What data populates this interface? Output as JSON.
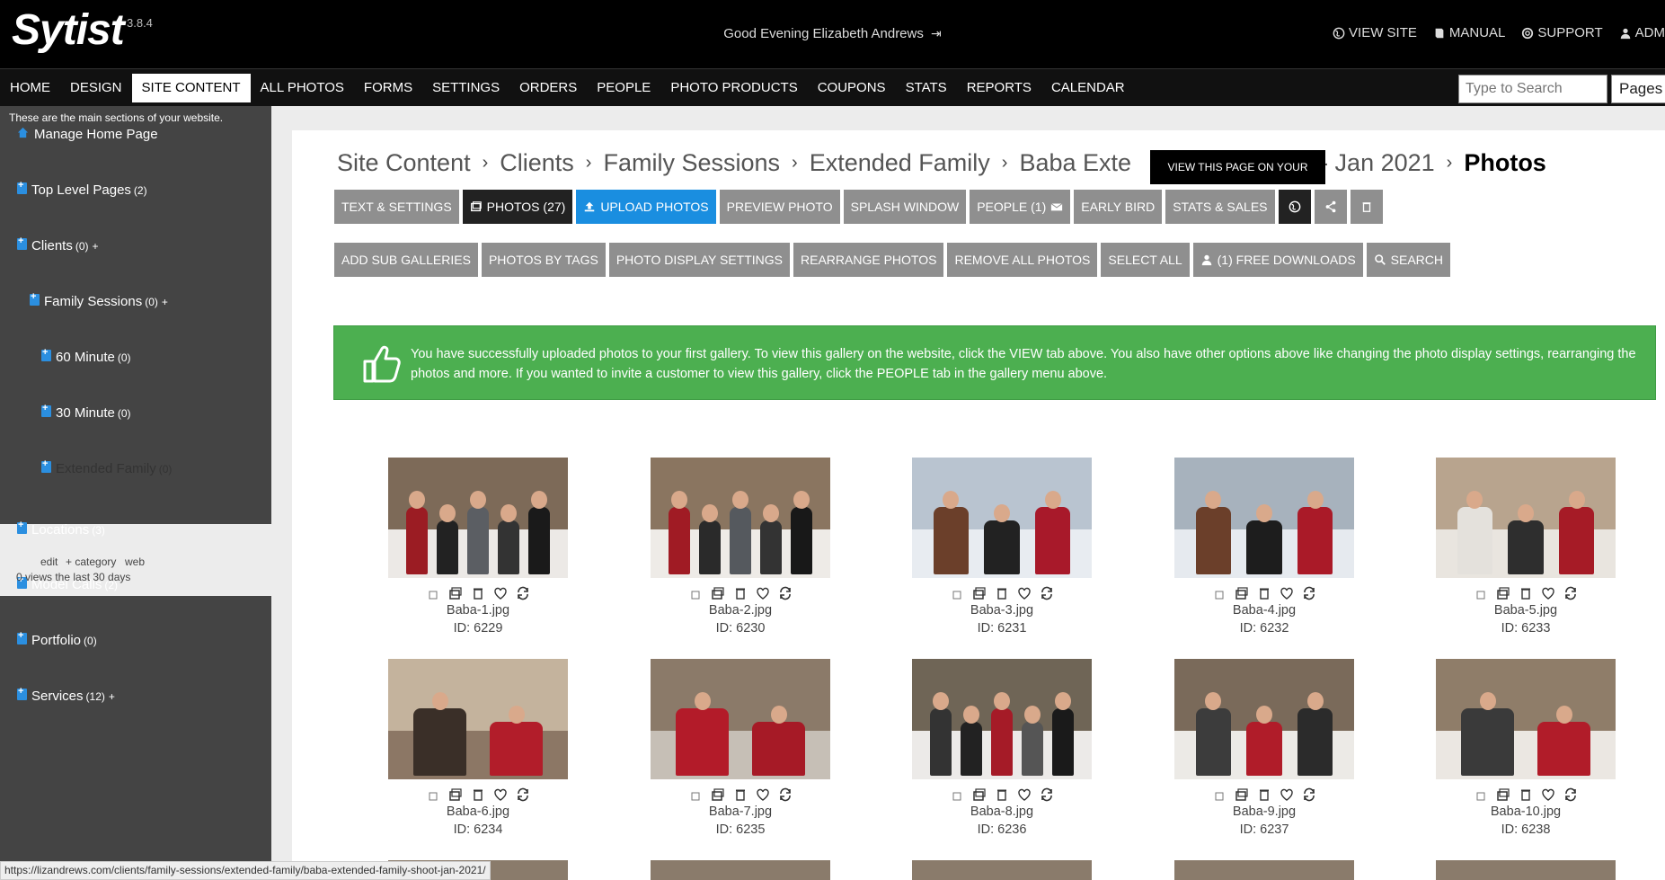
{
  "app": {
    "logo": "Sytist",
    "version": "3.8.4",
    "greeting": "Good Evening Elizabeth Andrews",
    "top_links": [
      {
        "label": "VIEW SITE",
        "icon": "globe-icon"
      },
      {
        "label": "MANUAL",
        "icon": "book-icon"
      },
      {
        "label": "SUPPORT",
        "icon": "lifebuoy-icon"
      },
      {
        "label": "ADM",
        "icon": "user-icon"
      }
    ]
  },
  "nav": {
    "items": [
      "HOME",
      "DESIGN",
      "SITE CONTENT",
      "ALL PHOTOS",
      "FORMS",
      "SETTINGS",
      "ORDERS",
      "PEOPLE",
      "PHOTO PRODUCTS",
      "COUPONS",
      "STATS",
      "REPORTS",
      "CALENDAR"
    ],
    "active": "SITE CONTENT",
    "search_placeholder": "Type to Search",
    "pages_select": "Pages"
  },
  "sidebar": {
    "note": "These are the main sections of your website.",
    "items": [
      {
        "label": "Manage Home Page",
        "count": "",
        "plus": ""
      },
      {
        "label": "Top Level Pages",
        "count": "(2)",
        "plus": ""
      },
      {
        "label": "Clients",
        "count": "(0)",
        "plus": "+"
      },
      {
        "label": "Family Sessions",
        "count": "(0)",
        "plus": "+"
      },
      {
        "label": "60 Minute",
        "count": "(0)",
        "plus": ""
      },
      {
        "label": "30 Minute",
        "count": "(0)",
        "plus": ""
      },
      {
        "label": "Extended Family",
        "count": "(0)",
        "plus": ""
      },
      {
        "label": "Locations",
        "count": "(3)",
        "plus": ""
      },
      {
        "label": "Model Calls",
        "count": "(2)",
        "plus": ""
      },
      {
        "label": "Portfolio",
        "count": "(0)",
        "plus": ""
      },
      {
        "label": "Services",
        "count": "(12)",
        "plus": "+"
      }
    ],
    "active_links": [
      "edit",
      "+ category",
      "web"
    ],
    "active_views": "0 views the last 30 days"
  },
  "breadcrumb": [
    "Site Content",
    "Clients",
    "Family Sessions",
    "Extended Family",
    "Baba Exte",
    "- Jan 2021",
    "Photos"
  ],
  "tooltip": "VIEW THIS PAGE ON YOUR WEBSITE",
  "toolbar1": [
    "TEXT & SETTINGS",
    "PHOTOS (27)",
    "UPLOAD PHOTOS",
    "PREVIEW PHOTO",
    "SPLASH WINDOW",
    "PEOPLE (1)",
    "EARLY BIRD",
    "STATS & SALES"
  ],
  "toolbar2": [
    "ADD SUB GALLERIES",
    "PHOTOS BY TAGS",
    "PHOTO DISPLAY SETTINGS",
    "REARRANGE PHOTOS",
    "REMOVE ALL PHOTOS",
    "SELECT ALL",
    "(1) FREE DOWNLOADS",
    "SEARCH"
  ],
  "alert": "You have successfully uploaded photos to your first gallery. To view this gallery on the website, click the VIEW tab above. You also have other options above like changing the photo display settings, rearranging the photos and more. If you wanted to invite a customer to view this gallery, click the PEOPLE tab in the gallery menu above.",
  "photos": [
    {
      "name": "Baba-1.jpg",
      "id": "ID: 6229"
    },
    {
      "name": "Baba-2.jpg",
      "id": "ID: 6230"
    },
    {
      "name": "Baba-3.jpg",
      "id": "ID: 6231"
    },
    {
      "name": "Baba-4.jpg",
      "id": "ID: 6232"
    },
    {
      "name": "Baba-5.jpg",
      "id": "ID: 6233"
    },
    {
      "name": "Baba-6.jpg",
      "id": "ID: 6234"
    },
    {
      "name": "Baba-7.jpg",
      "id": "ID: 6235"
    },
    {
      "name": "Baba-8.jpg",
      "id": "ID: 6236"
    },
    {
      "name": "Baba-9.jpg",
      "id": "ID: 6237"
    },
    {
      "name": "Baba-10.jpg",
      "id": "ID: 6238"
    }
  ],
  "status_url": "https://lizandrews.com/clients/family-sessions/extended-family/baba-extended-family-shoot-jan-2021/"
}
